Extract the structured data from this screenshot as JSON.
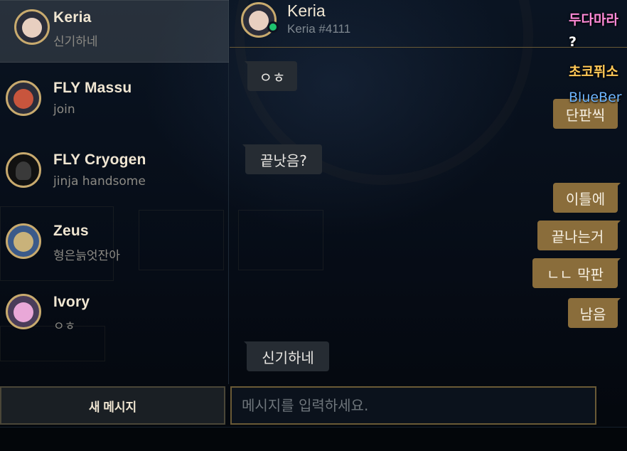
{
  "friends": [
    {
      "name": "Keria",
      "status": "신기하네",
      "avatar_color": "#e8cfc0",
      "active": true
    },
    {
      "name": "FLY Massu",
      "status": "join",
      "avatar_color": "#c8553d",
      "active": false
    },
    {
      "name": "FLY Cryogen",
      "status": "jinja handsome",
      "avatar_color": "#3a3a3a",
      "active": false
    },
    {
      "name": "Zeus",
      "status": "형은늙엇잔아",
      "avatar_color": "#c9b27a",
      "active": false
    },
    {
      "name": "Ivory",
      "status": "ㅇㅎ",
      "avatar_color": "#e9a8d8",
      "active": false
    }
  ],
  "new_message_button": "새 메시지",
  "chat": {
    "name": "Keria",
    "tag": "Keria #4111",
    "online_color": "#1ec36f",
    "messages": [
      {
        "dir": "in",
        "text": "ㅇㅎ"
      },
      {
        "dir": "out",
        "text": "단판씩"
      },
      {
        "dir": "in",
        "text": "끝낫음?"
      },
      {
        "dir": "out",
        "text": "이틀에"
      },
      {
        "dir": "out",
        "text": "끝나는거"
      },
      {
        "dir": "out",
        "text": "ㄴㄴ 막판"
      },
      {
        "dir": "out",
        "text": "남음"
      },
      {
        "dir": "in",
        "text": "신기하네"
      }
    ],
    "input_placeholder": "메시지를 입력하세요."
  },
  "overlay_chat": [
    {
      "text": "두다마라",
      "color": "#ff8ad8"
    },
    {
      "text": "?",
      "color": "#ffffff"
    },
    {
      "text": "초코퓌소",
      "color": "#ffc857"
    },
    {
      "text": "BlueBer",
      "color": "#6fb6ff"
    }
  ],
  "colors": {
    "gold_accent": "#c8aa6e",
    "outgoing_bubble": "#8a6d3b",
    "incoming_bubble": "#262c33"
  }
}
